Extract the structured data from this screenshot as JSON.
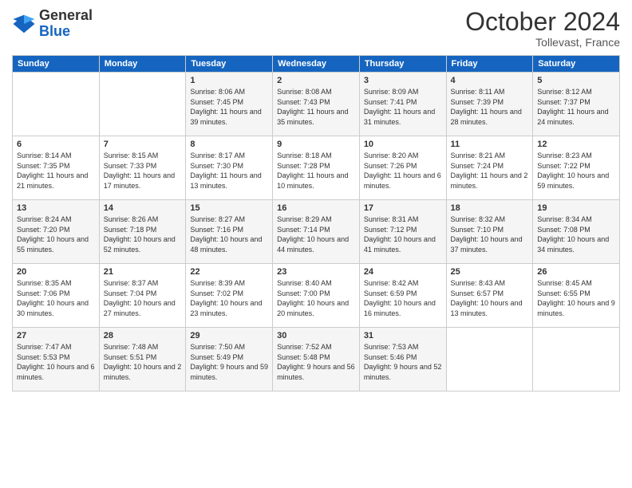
{
  "header": {
    "logo_general": "General",
    "logo_blue": "Blue",
    "month": "October 2024",
    "location": "Tollevast, France"
  },
  "weekdays": [
    "Sunday",
    "Monday",
    "Tuesday",
    "Wednesday",
    "Thursday",
    "Friday",
    "Saturday"
  ],
  "weeks": [
    [
      {
        "day": "",
        "info": ""
      },
      {
        "day": "",
        "info": ""
      },
      {
        "day": "1",
        "info": "Sunrise: 8:06 AM\nSunset: 7:45 PM\nDaylight: 11 hours and 39 minutes."
      },
      {
        "day": "2",
        "info": "Sunrise: 8:08 AM\nSunset: 7:43 PM\nDaylight: 11 hours and 35 minutes."
      },
      {
        "day": "3",
        "info": "Sunrise: 8:09 AM\nSunset: 7:41 PM\nDaylight: 11 hours and 31 minutes."
      },
      {
        "day": "4",
        "info": "Sunrise: 8:11 AM\nSunset: 7:39 PM\nDaylight: 11 hours and 28 minutes."
      },
      {
        "day": "5",
        "info": "Sunrise: 8:12 AM\nSunset: 7:37 PM\nDaylight: 11 hours and 24 minutes."
      }
    ],
    [
      {
        "day": "6",
        "info": "Sunrise: 8:14 AM\nSunset: 7:35 PM\nDaylight: 11 hours and 21 minutes."
      },
      {
        "day": "7",
        "info": "Sunrise: 8:15 AM\nSunset: 7:33 PM\nDaylight: 11 hours and 17 minutes."
      },
      {
        "day": "8",
        "info": "Sunrise: 8:17 AM\nSunset: 7:30 PM\nDaylight: 11 hours and 13 minutes."
      },
      {
        "day": "9",
        "info": "Sunrise: 8:18 AM\nSunset: 7:28 PM\nDaylight: 11 hours and 10 minutes."
      },
      {
        "day": "10",
        "info": "Sunrise: 8:20 AM\nSunset: 7:26 PM\nDaylight: 11 hours and 6 minutes."
      },
      {
        "day": "11",
        "info": "Sunrise: 8:21 AM\nSunset: 7:24 PM\nDaylight: 11 hours and 2 minutes."
      },
      {
        "day": "12",
        "info": "Sunrise: 8:23 AM\nSunset: 7:22 PM\nDaylight: 10 hours and 59 minutes."
      }
    ],
    [
      {
        "day": "13",
        "info": "Sunrise: 8:24 AM\nSunset: 7:20 PM\nDaylight: 10 hours and 55 minutes."
      },
      {
        "day": "14",
        "info": "Sunrise: 8:26 AM\nSunset: 7:18 PM\nDaylight: 10 hours and 52 minutes."
      },
      {
        "day": "15",
        "info": "Sunrise: 8:27 AM\nSunset: 7:16 PM\nDaylight: 10 hours and 48 minutes."
      },
      {
        "day": "16",
        "info": "Sunrise: 8:29 AM\nSunset: 7:14 PM\nDaylight: 10 hours and 44 minutes."
      },
      {
        "day": "17",
        "info": "Sunrise: 8:31 AM\nSunset: 7:12 PM\nDaylight: 10 hours and 41 minutes."
      },
      {
        "day": "18",
        "info": "Sunrise: 8:32 AM\nSunset: 7:10 PM\nDaylight: 10 hours and 37 minutes."
      },
      {
        "day": "19",
        "info": "Sunrise: 8:34 AM\nSunset: 7:08 PM\nDaylight: 10 hours and 34 minutes."
      }
    ],
    [
      {
        "day": "20",
        "info": "Sunrise: 8:35 AM\nSunset: 7:06 PM\nDaylight: 10 hours and 30 minutes."
      },
      {
        "day": "21",
        "info": "Sunrise: 8:37 AM\nSunset: 7:04 PM\nDaylight: 10 hours and 27 minutes."
      },
      {
        "day": "22",
        "info": "Sunrise: 8:39 AM\nSunset: 7:02 PM\nDaylight: 10 hours and 23 minutes."
      },
      {
        "day": "23",
        "info": "Sunrise: 8:40 AM\nSunset: 7:00 PM\nDaylight: 10 hours and 20 minutes."
      },
      {
        "day": "24",
        "info": "Sunrise: 8:42 AM\nSunset: 6:59 PM\nDaylight: 10 hours and 16 minutes."
      },
      {
        "day": "25",
        "info": "Sunrise: 8:43 AM\nSunset: 6:57 PM\nDaylight: 10 hours and 13 minutes."
      },
      {
        "day": "26",
        "info": "Sunrise: 8:45 AM\nSunset: 6:55 PM\nDaylight: 10 hours and 9 minutes."
      }
    ],
    [
      {
        "day": "27",
        "info": "Sunrise: 7:47 AM\nSunset: 5:53 PM\nDaylight: 10 hours and 6 minutes."
      },
      {
        "day": "28",
        "info": "Sunrise: 7:48 AM\nSunset: 5:51 PM\nDaylight: 10 hours and 2 minutes."
      },
      {
        "day": "29",
        "info": "Sunrise: 7:50 AM\nSunset: 5:49 PM\nDaylight: 9 hours and 59 minutes."
      },
      {
        "day": "30",
        "info": "Sunrise: 7:52 AM\nSunset: 5:48 PM\nDaylight: 9 hours and 56 minutes."
      },
      {
        "day": "31",
        "info": "Sunrise: 7:53 AM\nSunset: 5:46 PM\nDaylight: 9 hours and 52 minutes."
      },
      {
        "day": "",
        "info": ""
      },
      {
        "day": "",
        "info": ""
      }
    ]
  ]
}
